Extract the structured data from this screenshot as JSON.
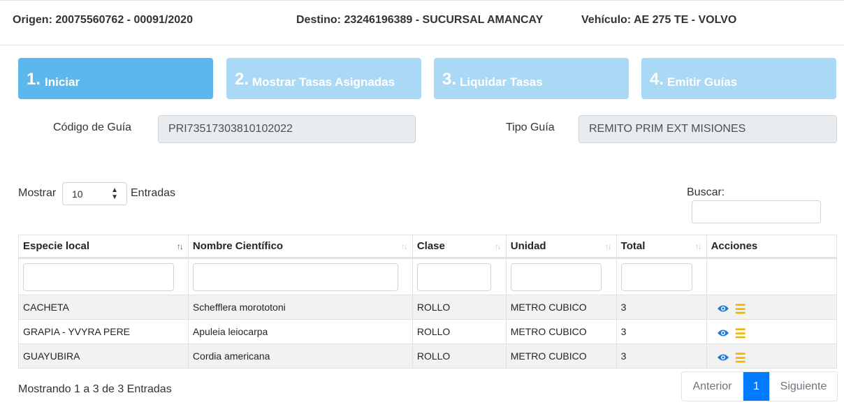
{
  "header": {
    "origen": "Origen: 20075560762 - 00091/2020",
    "destino": "Destino: 23246196389 - SUCURSAL AMANCAY",
    "vehiculo": "Vehículo: AE 275 TE - VOLVO"
  },
  "steps": [
    {
      "num": "1.",
      "label": "Iniciar"
    },
    {
      "num": "2.",
      "label": "Mostrar Tasas Asignadas"
    },
    {
      "num": "3.",
      "label": "Liquidar Tasas"
    },
    {
      "num": "4.",
      "label": "Emitir Guías"
    }
  ],
  "form": {
    "codigo_label": "Código de Guía",
    "codigo_value": "PRI73517303810102022",
    "tipo_label": "Tipo Guía",
    "tipo_value": "REMITO PRIM EXT MISIONES"
  },
  "table_controls": {
    "mostrar": "Mostrar",
    "page_size": "10",
    "entradas": "Entradas",
    "buscar": "Buscar:"
  },
  "columns": [
    "Especie local",
    "Nombre Científico",
    "Clase",
    "Unidad",
    "Total",
    "Acciones"
  ],
  "rows": [
    {
      "especie": "CACHETA",
      "nombre": "Schefflera morototoni",
      "clase": "ROLLO",
      "unidad": "METRO CUBICO",
      "total": "3"
    },
    {
      "especie": "GRAPIA - YVYRA PERE",
      "nombre": "Apuleia leiocarpa",
      "clase": "ROLLO",
      "unidad": "METRO CUBICO",
      "total": "3"
    },
    {
      "especie": "GUAYUBIRA",
      "nombre": "Cordia americana",
      "clase": "ROLLO",
      "unidad": "METRO CUBICO",
      "total": "3"
    }
  ],
  "footer": {
    "info": "Mostrando 1 a 3 de 3 Entradas",
    "prev": "Anterior",
    "page": "1",
    "next": "Siguiente"
  },
  "icons": {
    "view": "eye-icon",
    "menu": "menu-icon",
    "sort": "sort-icon"
  },
  "colors": {
    "step_active": "#5bb7ec",
    "step_inactive": "#aad9f6",
    "pager_active": "#007bff",
    "eye": "#1f7bd0",
    "menu": "#f0b400"
  }
}
